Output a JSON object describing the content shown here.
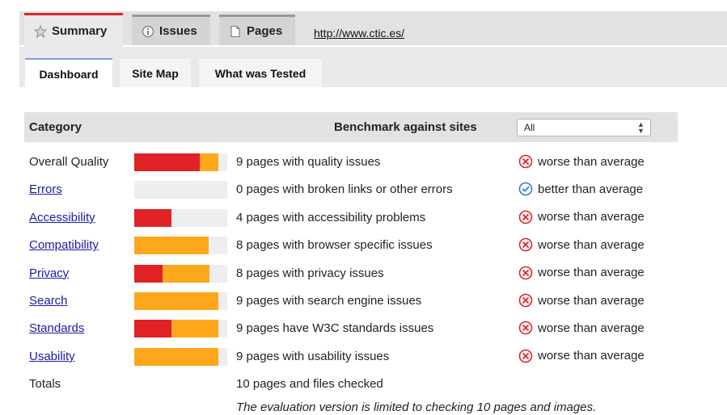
{
  "tabs": [
    {
      "label": "Summary",
      "icon": "star-icon",
      "active": true
    },
    {
      "label": "Issues",
      "icon": "info-icon",
      "active": false
    },
    {
      "label": "Pages",
      "icon": "page-icon",
      "active": false
    }
  ],
  "url": "http://www.ctic.es/",
  "subtabs": [
    {
      "label": "Dashboard",
      "active": true
    },
    {
      "label": "Site Map",
      "active": false
    },
    {
      "label": "What was Tested",
      "active": false
    }
  ],
  "table": {
    "header_category": "Category",
    "header_benchmark": "Benchmark against sites",
    "benchmark_select_value": "All"
  },
  "rows": [
    {
      "category": "Overall Quality",
      "link": false,
      "red_fraction": 0.7,
      "orange_fraction": 0.2,
      "description": "9 pages with quality issues",
      "benchmark": "worse than average",
      "status": "worse"
    },
    {
      "category": "Errors",
      "link": true,
      "red_fraction": 0.0,
      "orange_fraction": 0.0,
      "description": "0 pages with broken links or other errors",
      "benchmark": "better than average",
      "status": "better"
    },
    {
      "category": "Accessibility",
      "link": true,
      "red_fraction": 0.4,
      "orange_fraction": 0.0,
      "description": "4 pages with accessibility problems",
      "benchmark": "worse than average",
      "status": "worse"
    },
    {
      "category": "Compatibility",
      "link": true,
      "red_fraction": 0.0,
      "orange_fraction": 0.8,
      "description": "8 pages with browser specific issues",
      "benchmark": "worse than average",
      "status": "worse"
    },
    {
      "category": "Privacy",
      "link": true,
      "red_fraction": 0.3,
      "orange_fraction": 0.5,
      "description": "8 pages with privacy issues",
      "benchmark": "worse than average",
      "status": "worse"
    },
    {
      "category": "Search",
      "link": true,
      "red_fraction": 0.0,
      "orange_fraction": 0.9,
      "description": "9 pages with search engine issues",
      "benchmark": "worse than average",
      "status": "worse"
    },
    {
      "category": "Standards",
      "link": true,
      "red_fraction": 0.4,
      "orange_fraction": 0.5,
      "description": "9 pages have W3C standards issues",
      "benchmark": "worse than average",
      "status": "worse"
    },
    {
      "category": "Usability",
      "link": true,
      "red_fraction": 0.0,
      "orange_fraction": 0.9,
      "description": "9 pages with usability issues",
      "benchmark": "worse than average",
      "status": "worse"
    }
  ],
  "totals": {
    "label": "Totals",
    "description": "10 pages and files checked"
  },
  "note": "The evaluation version is limited to checking 10 pages and images.",
  "colors": {
    "red": "#e02224",
    "orange": "#fca71c",
    "worse": "#d8272a",
    "better": "#2f7bd9"
  }
}
